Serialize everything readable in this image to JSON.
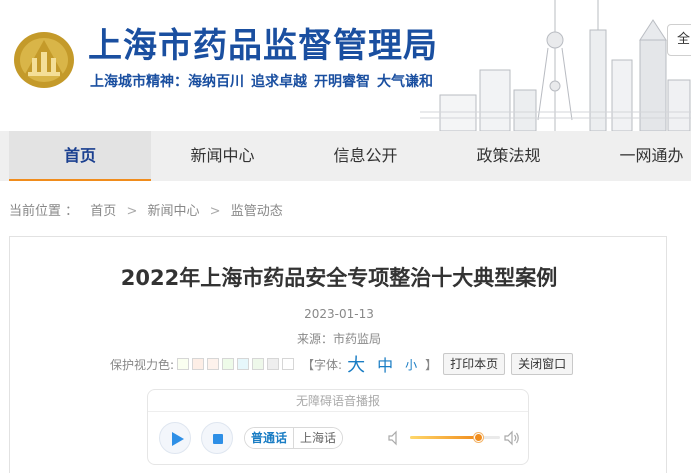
{
  "header": {
    "title": "上海市药品监督管理局",
    "motto": [
      "上海城市精神：海纳百川",
      "追求卓越",
      "开明睿智",
      "大气谦和"
    ],
    "search_button_label": "全"
  },
  "nav": {
    "items": [
      {
        "label": "首页",
        "active": true
      },
      {
        "label": "新闻中心",
        "active": false
      },
      {
        "label": "信息公开",
        "active": false
      },
      {
        "label": "政策法规",
        "active": false
      },
      {
        "label": "一网通办",
        "active": false
      }
    ],
    "accent_color": "#f08c1c"
  },
  "breadcrumb": {
    "label": "当前位置 ：",
    "items": [
      "首页",
      "新闻中心",
      "监管动态"
    ],
    "separator": ">"
  },
  "article": {
    "title": "2022年上海市药品安全专项整治十大典型案例",
    "date": "2023-01-13",
    "source": "来源：市药监局"
  },
  "tools": {
    "eye_care_label": "保护视力色:",
    "swatch_colors": [
      "#fafff0",
      "#fdeee6",
      "#fdf2ec",
      "#eefbe9",
      "#e6f7fb",
      "#eef8ea",
      "#eeeeee",
      "#ffffff"
    ],
    "font_label": "【字体:",
    "font_big": "大",
    "font_mid": "中",
    "font_small": "小",
    "font_close": "】",
    "print_label": "打印本页",
    "close_label": "关闭窗口"
  },
  "player": {
    "header": "无障碍语音播报",
    "languages": [
      {
        "label": "普通话",
        "active": true
      },
      {
        "label": "上海话",
        "active": false
      }
    ],
    "volume": 0.75
  },
  "colors": {
    "brand_blue": "#1a4fa0",
    "link_blue": "#1a7dc4",
    "play_blue": "#2e8fe6"
  }
}
